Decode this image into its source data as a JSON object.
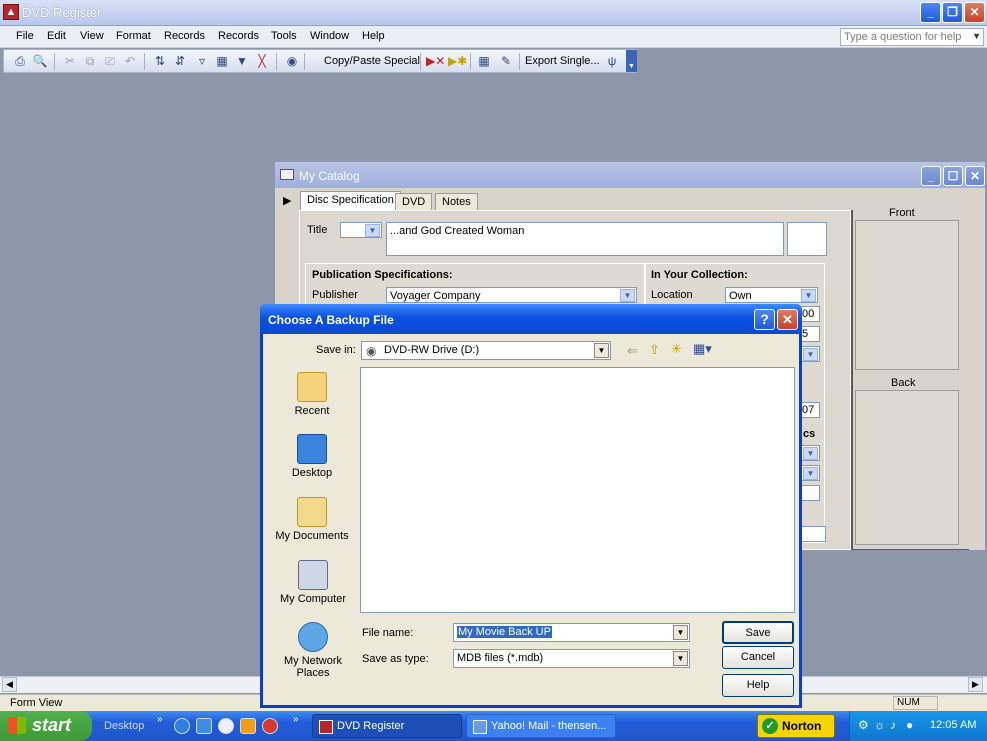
{
  "app": {
    "title": "DVD Register",
    "icon": "access-form-icon",
    "help_placeholder": "Type a question for help",
    "menus": [
      "File",
      "Edit",
      "View",
      "Format",
      "Records",
      "Records",
      "Tools",
      "Window",
      "Help"
    ],
    "toolbar": {
      "copy_paste_special": "Copy/Paste Special",
      "export_single": "Export Single..."
    }
  },
  "catalog": {
    "title": "My Catalog",
    "tabs": [
      "Disc Specification",
      "DVD",
      "Notes"
    ],
    "title_label": "Title",
    "title_value": "...and God Created Woman",
    "pub_header": "Publication Specifications:",
    "publisher_label": "Publisher",
    "publisher_value": "Voyager Company",
    "coll_header": "In Your Collection:",
    "location_label": "Location",
    "location_value": "Own",
    "partial_values": [
      "00",
      "5",
      "07",
      "cs"
    ],
    "front_label": "Front",
    "back_label": "Back"
  },
  "dialog": {
    "title": "Choose A Backup File",
    "save_in_label": "Save in:",
    "save_in_value": "DVD-RW Drive (D:)",
    "places": [
      "Recent",
      "Desktop",
      "My Documents",
      "My Computer",
      "My Network Places"
    ],
    "file_name_label": "File name:",
    "file_name_value": "My Movie Back UP",
    "save_type_label": "Save as type:",
    "save_type_value": "MDB files (*.mdb)",
    "buttons": {
      "save": "Save",
      "cancel": "Cancel",
      "help": "Help"
    }
  },
  "statusbar": {
    "left": "Form View",
    "num": "NUM"
  },
  "taskbar": {
    "start": "start",
    "desktop": "Desktop",
    "tasks": [
      "DVD Register",
      "Yahoo! Mail - thensen..."
    ],
    "norton": "Norton",
    "time": "12:05 AM"
  },
  "colors": {
    "xp_blue": "#0a52e0",
    "start_green": "#3c9b35",
    "workspace": "#8e97a9"
  }
}
